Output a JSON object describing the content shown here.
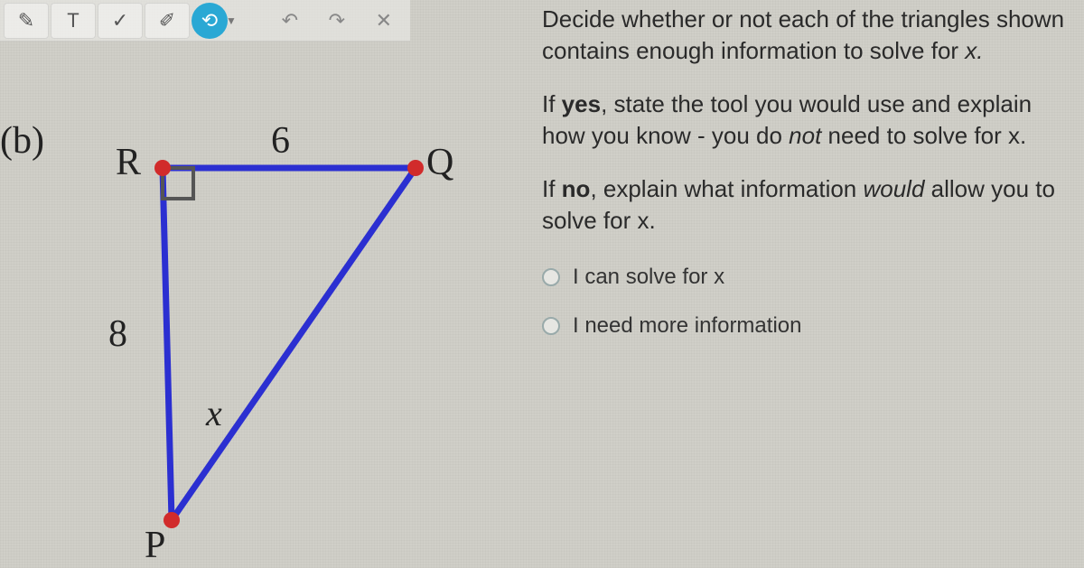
{
  "toolbar": {
    "pen_icon": "✎",
    "text_tool": "T",
    "check_tool": "✓",
    "eraser_icon": "✐",
    "lasso_icon": "⟲",
    "undo_icon": "↶",
    "redo_icon": "↷",
    "close_icon": "✕"
  },
  "problem": {
    "part_label": "(b)",
    "triangle": {
      "vertices": {
        "R": "R",
        "Q": "Q",
        "P": "P"
      },
      "side_RQ": "6",
      "side_RP": "8",
      "side_QP": "x",
      "right_angle_at": "R"
    }
  },
  "instructions": {
    "p1_pre": "Decide whether or not each of the triangles shown contains enough information to solve for ",
    "p1_var": "x.",
    "p2_pre": "If ",
    "p2_bold": "yes",
    "p2_mid": ", state the tool you would use and explain how you know - you do ",
    "p2_ital": "not",
    "p2_suf": " need to solve for x.",
    "p3_pre": "If ",
    "p3_bold": "no",
    "p3_mid": ", explain what information ",
    "p3_ital": "would",
    "p3_suf": " allow you to solve for x."
  },
  "options": {
    "opt1": "I can solve for x",
    "opt2": "I need more information"
  }
}
